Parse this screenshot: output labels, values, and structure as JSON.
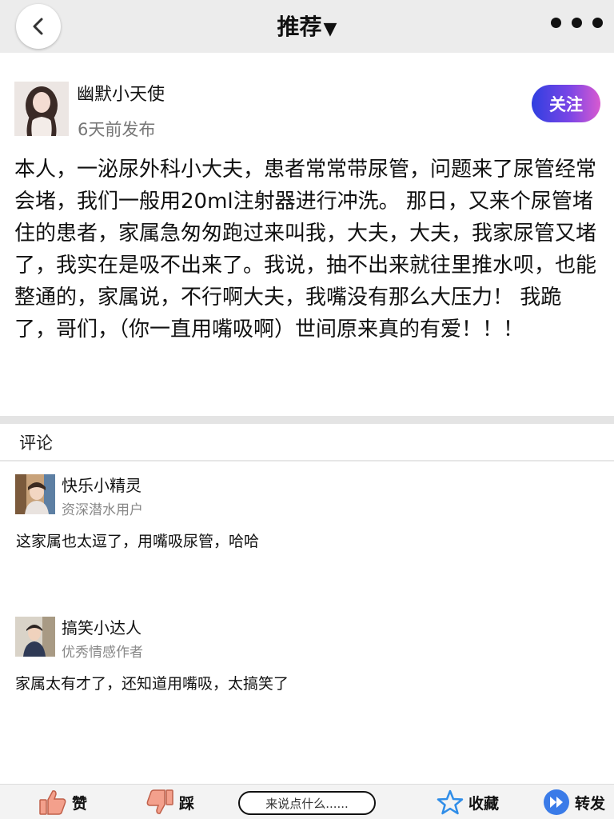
{
  "header": {
    "title": "推荐",
    "title_caret": "▼",
    "back_icon": "chevron-left-icon",
    "more_icon": "more-dots-icon"
  },
  "post": {
    "author": "幽默小天使",
    "time": "6天前发布",
    "follow_label": "关注",
    "body": "本人，一泌尿外科小大夫，患者常常带尿管，问题来了尿管经常会堵，我们一般用20ml注射器进行冲洗。 那日，又来个尿管堵住的患者，家属急匆匆跑过来叫我，大夫，大夫，我家尿管又堵了，我实在是吸不出来了。我说，抽不出来就往里推水呗，也能整通的，家属说，不行啊大夫，我嘴没有那么大压力！ 我跪了，哥们，（你一直用嘴吸啊）世间原来真的有爱！！！"
  },
  "comments_section": {
    "header": "评论",
    "items": [
      {
        "name": "快乐小精灵",
        "subtitle": "资深潜水用户",
        "text": "这家属也太逗了，用嘴吸尿管，哈哈"
      },
      {
        "name": "搞笑小达人",
        "subtitle": "优秀情感作者",
        "text": "家属太有才了，还知道用嘴吸，太搞笑了"
      }
    ]
  },
  "bottom_bar": {
    "like_label": "赞",
    "dislike_label": "踩",
    "input_placeholder": "来说点什么......",
    "favorite_label": "收藏",
    "share_label": "转发"
  },
  "colors": {
    "follow_gradient": [
      "#2f3fe0",
      "#7a45e6",
      "#d85ad0"
    ],
    "like_icon": "#f3a08c",
    "star_icon": "#2f8de8",
    "share_icon": "#3a7be8"
  }
}
